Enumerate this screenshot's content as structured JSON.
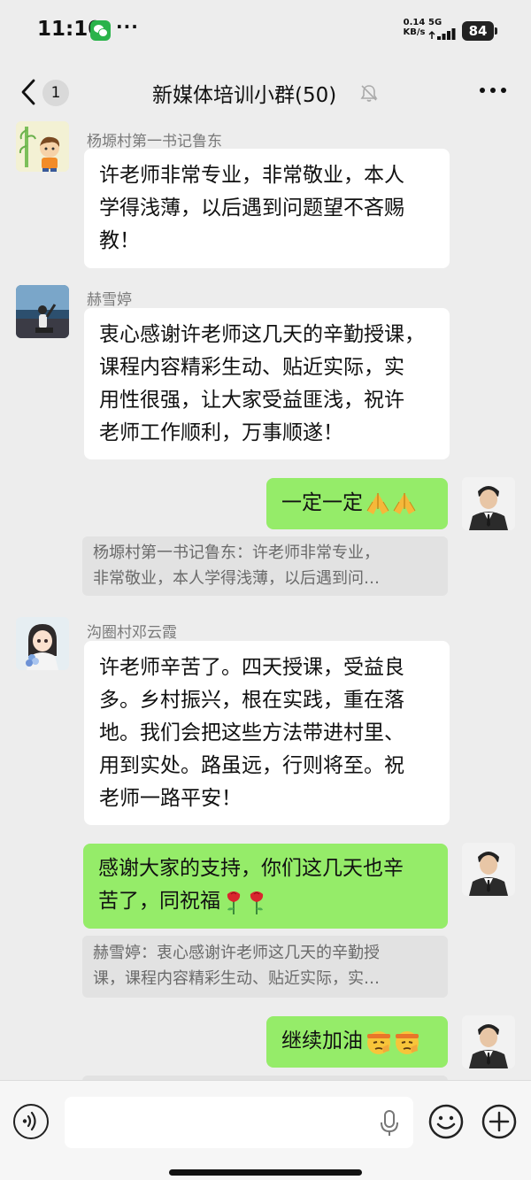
{
  "status_bar": {
    "time": "11:10",
    "dots": "···",
    "net_speed_value": "0.14",
    "net_speed_unit": "KB/s",
    "network": "5G",
    "battery": "84"
  },
  "nav": {
    "back_icon": "chevron-left-icon",
    "unread_count": "1",
    "title": "新媒体培训小群(50)",
    "mute_icon": "bell-slash-icon",
    "more_icon": "ellipsis-icon"
  },
  "messages": [
    {
      "direction": "in",
      "sender": "杨塬村第一书记鲁东",
      "lines": [
        "许老师非常专业，非常敬业，本人",
        "学得浅薄，以后遇到问题望不吝赐",
        "教！"
      ]
    },
    {
      "direction": "in",
      "sender": "赫雪婷",
      "lines": [
        "衷心感谢许老师这几天的辛勤授课，",
        "课程内容精彩生动、贴近实际，实",
        "用性很强，让大家受益匪浅，祝许",
        "老师工作顺利，万事顺遂！"
      ]
    },
    {
      "direction": "out",
      "lines": [
        "一定一定"
      ],
      "emojis": [
        "folded-hands-emoji",
        "folded-hands-emoji"
      ],
      "quote": [
        "杨塬村第一书记鲁东：许老师非常专业，",
        "非常敬业，本人学得浅薄，以后遇到问…"
      ]
    },
    {
      "direction": "in",
      "sender": "沟圈村邓云霞",
      "lines": [
        "许老师辛苦了。四天授课，受益良",
        "多。乡村振兴，根在实践，重在落",
        "地。我们会把这些方法带进村里、",
        "用到实处。路虽远，行则将至。祝",
        "老师一路平安！"
      ]
    },
    {
      "direction": "out",
      "lines": [
        "感谢大家的支持，你们这几天也辛",
        "苦了，同祝福"
      ],
      "emojis": [
        "rose-emoji",
        "rose-emoji"
      ],
      "quote": [
        "赫雪婷：衷心感谢许老师这几天的辛勤授",
        "课，课程内容精彩生动、贴近实际，实…"
      ]
    },
    {
      "direction": "out",
      "lines": [
        "继续加油"
      ],
      "emojis": [
        "saluting-face-emoji",
        "saluting-face-emoji"
      ]
    }
  ],
  "input_bar": {
    "voice_icon": "voice-icon",
    "mic_icon": "microphone-icon",
    "emoji_icon": "smiley-icon",
    "plus_icon": "plus-circle-icon"
  },
  "colors": {
    "background": "#ededed",
    "outgoing_bubble": "#95ec69",
    "incoming_bubble": "#ffffff",
    "quote_background": "#e2e2e2",
    "sender_name": "#7a7a7a"
  }
}
